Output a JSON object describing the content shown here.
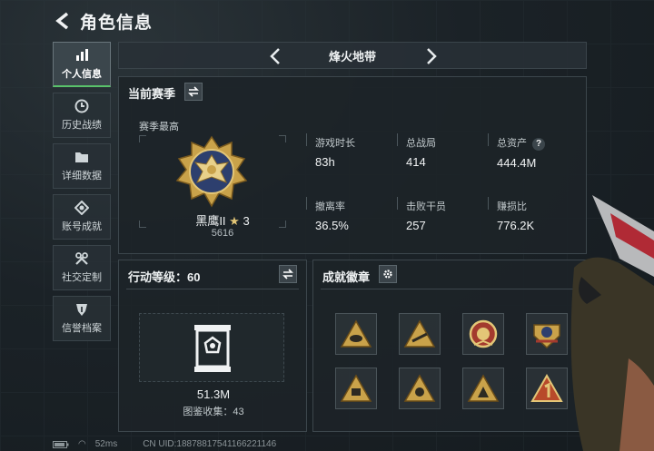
{
  "header": {
    "title": "角色信息",
    "back_icon": "back-arrow-icon"
  },
  "sidebar": {
    "items": [
      {
        "label": "个人信息",
        "icon": "bar-chart-icon",
        "active": true
      },
      {
        "label": "历史战绩",
        "icon": "clock-icon",
        "active": false
      },
      {
        "label": "详细数据",
        "icon": "folder-icon",
        "active": false
      },
      {
        "label": "账号成就",
        "icon": "achievement-icon",
        "active": false
      },
      {
        "label": "社交定制",
        "icon": "tools-icon",
        "active": false
      },
      {
        "label": "信誉档案",
        "icon": "shield-icon",
        "active": false
      }
    ]
  },
  "map_selector": {
    "current": "烽火地带"
  },
  "season": {
    "title": "当前赛季",
    "peak_label": "赛季最高",
    "rank": {
      "name": "黑鹰II",
      "stars": "3",
      "score": "5616"
    },
    "stats": [
      {
        "label": "游戏时长",
        "value": "83h"
      },
      {
        "label": "总战局",
        "value": "414"
      },
      {
        "label": "总资产",
        "value": "444.4M",
        "help": "?"
      },
      {
        "label": "撤离率",
        "value": "36.5%"
      },
      {
        "label": "击败干员",
        "value": "257"
      },
      {
        "label": "赚损比",
        "value": "776.2K"
      }
    ]
  },
  "level": {
    "title": "行动等级：60",
    "value": "51.3M",
    "collection": "图鉴收集：43"
  },
  "badges": {
    "title": "成就徽章",
    "count": 8
  },
  "footer": {
    "ping": "52ms",
    "uid": "CN UID:18878817541166221146"
  },
  "colors": {
    "accent": "#59c26a",
    "gold": "#c9a24a",
    "panel": "#1c2328"
  }
}
